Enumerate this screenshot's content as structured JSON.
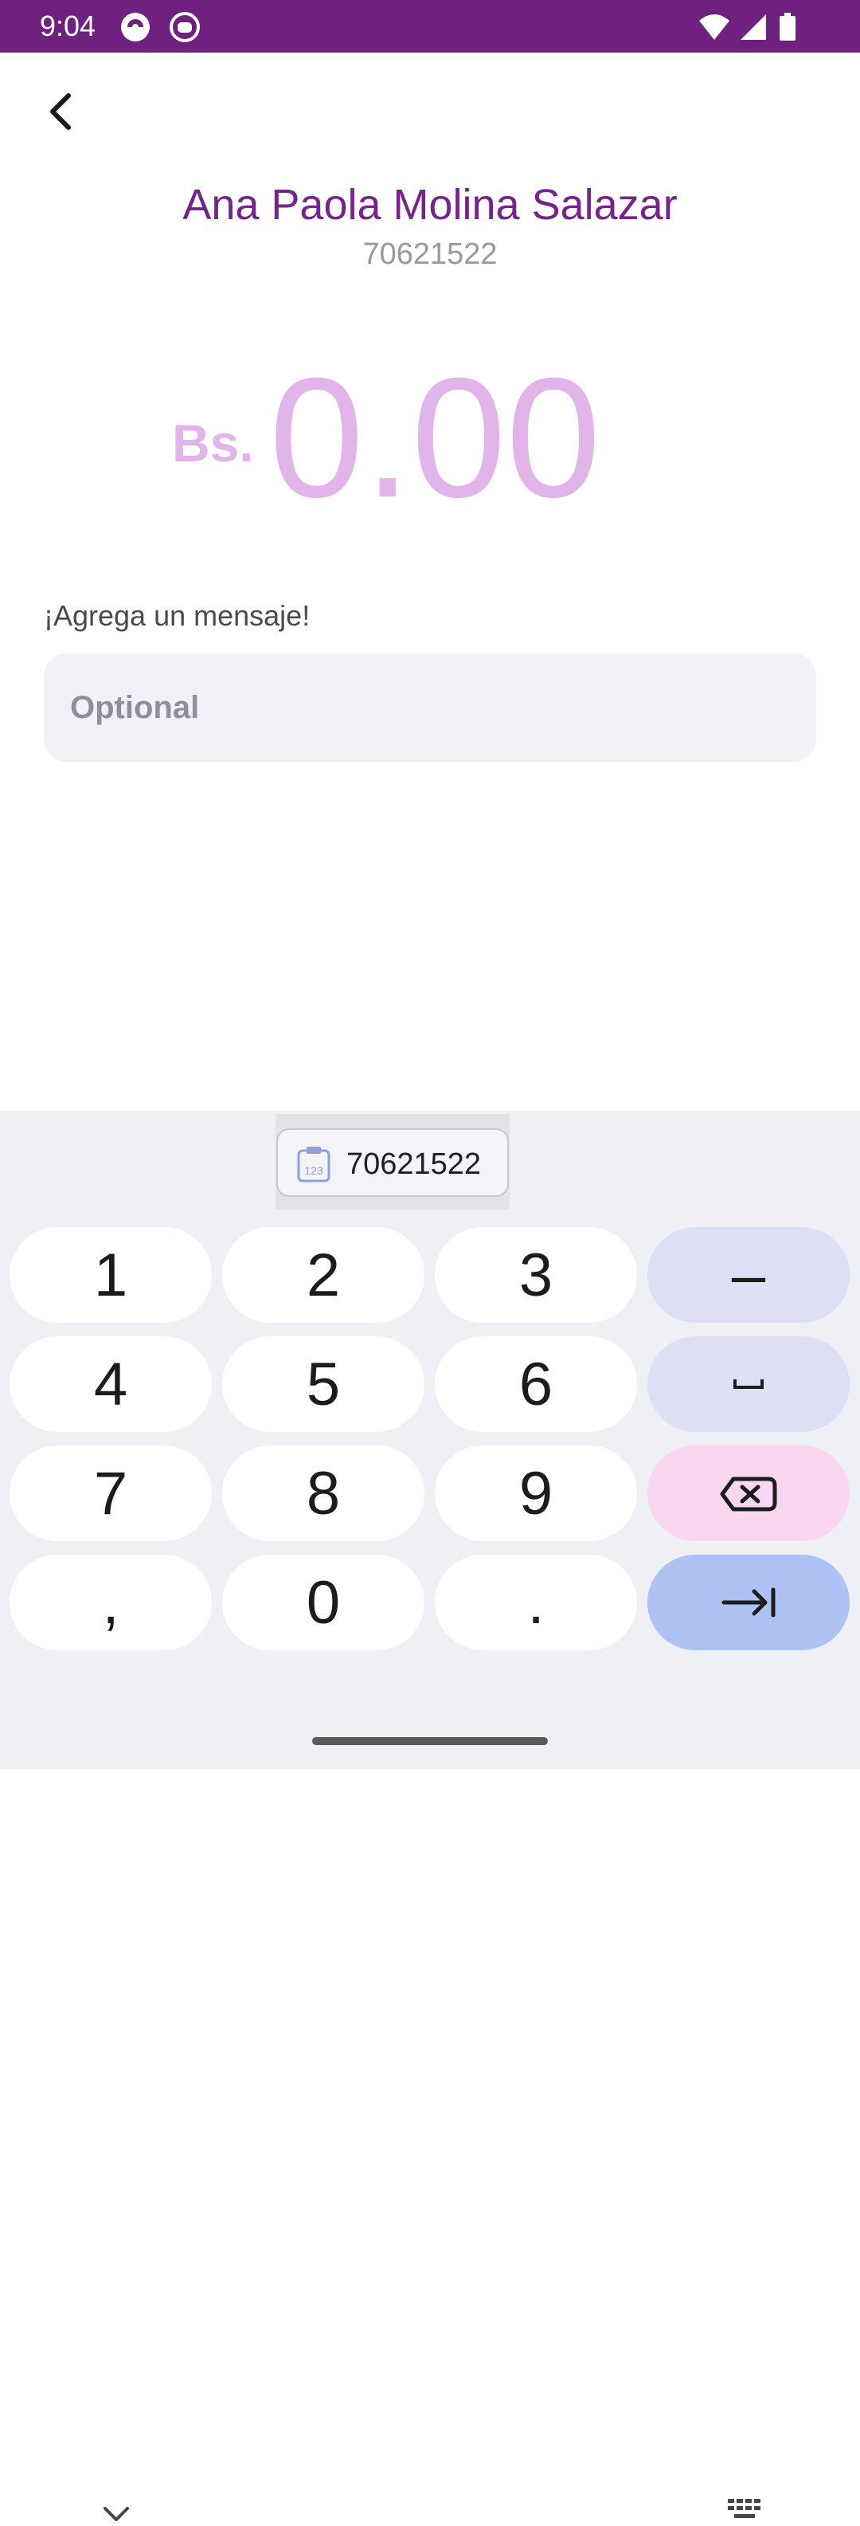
{
  "status_bar": {
    "time": "9:04"
  },
  "header": {
    "contact_name": "Ana Paola Molina Salazar",
    "contact_phone": "70621522"
  },
  "amount": {
    "currency": "Bs.",
    "value": "0.00"
  },
  "message": {
    "label": "¡Agrega un mensaje!",
    "placeholder": "Optional"
  },
  "keyboard": {
    "clipboard_suggestion": "70621522",
    "keys": {
      "k1": "1",
      "k2": "2",
      "k3": "3",
      "k4": "4",
      "k5": "5",
      "k6": "6",
      "k7": "7",
      "k8": "8",
      "k9": "9",
      "comma": ",",
      "k0": "0",
      "period": ".",
      "minus": "–"
    }
  },
  "colors": {
    "status_bar": "#6f2180",
    "accent_name": "#74248a",
    "amount_placeholder": "#e2b5ea",
    "key_function": "#dde0f5",
    "key_delete": "#f9d7f0",
    "key_enter": "#aec3f4"
  },
  "icons": {
    "back": "chevron-left-icon",
    "delete": "backspace-icon",
    "enter": "tab-arrow-icon",
    "space": "space-bar-icon",
    "clipboard": "clipboard-numbers-icon",
    "hide_keyboard": "chevron-down-icon",
    "switch_keyboard": "keyboard-icon"
  }
}
